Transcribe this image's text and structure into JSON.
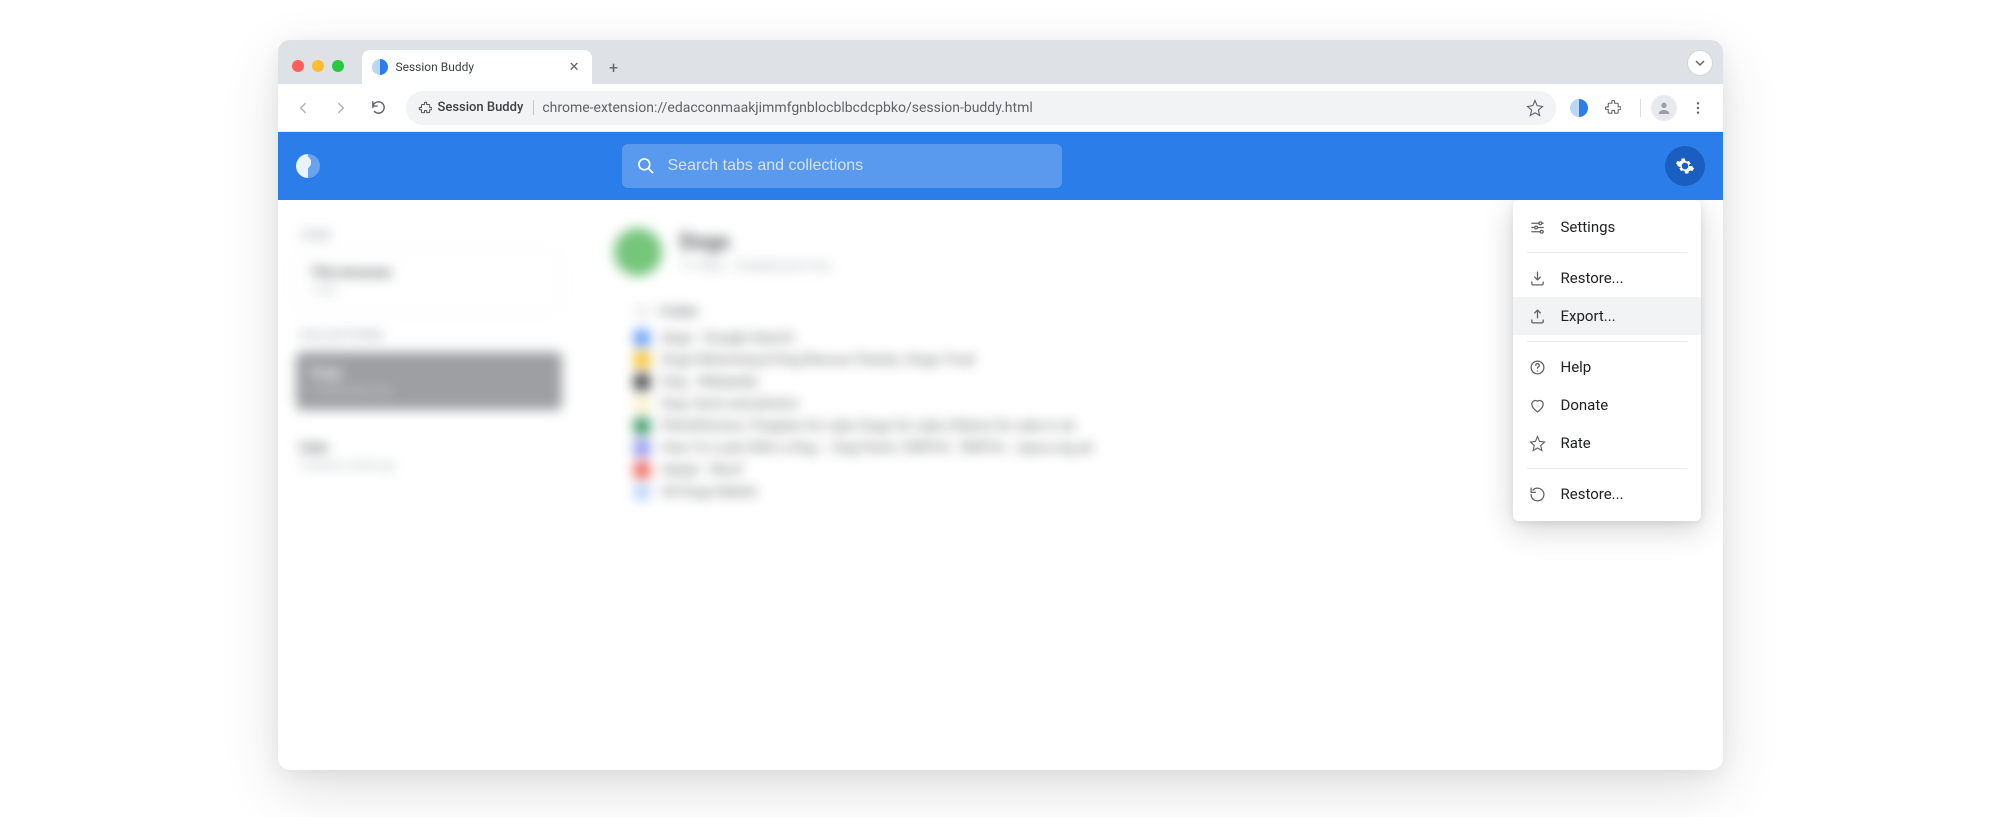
{
  "browser": {
    "tab_title": "Session Buddy",
    "omnibox_chip": "Session Buddy",
    "url": "chrome-extension://edacconmaakjimmfgnblocblbcdcpbko/session-buddy.html"
  },
  "app": {
    "search_placeholder": "Search tabs and collections"
  },
  "sidebar": {
    "section_tabs": "TABS",
    "this_browser": {
      "title": "This browser",
      "sub": "1 tab"
    },
    "section_collections": "COLLECTIONS",
    "dogs": {
      "title": "Dogs",
      "sub": "Created just now"
    },
    "cats": {
      "title": "Cats",
      "sub": "Created a while ago"
    }
  },
  "main": {
    "title": "Dogs",
    "subtitle": "17 links  ·  Created just now",
    "folder": "Folder",
    "links": [
      {
        "color": "#4285f4",
        "text": "dogs - Google Search"
      },
      {
        "color": "#f4b400",
        "text": "Dogs Rehoming & Dog Rescue Charity | Dogs Trust"
      },
      {
        "color": "#202124",
        "text": "Dog - Wikipedia"
      },
      {
        "color": "#fbecc0",
        "text": "Dog: facts and photos"
      },
      {
        "color": "#0b8043",
        "text": "Pets4Homes | Puppies for sale, Dogs for sale, Kittens for sale in uk"
      },
      {
        "color": "#7a7ceb",
        "text": "How To Look After a Dog – Dog Facts | RSPCA - RSPCA - rspca.org.uk"
      },
      {
        "color": "#ea4335",
        "text": "Adopt · Woof"
      },
      {
        "color": "#aecbfa",
        "text": "All Dogs Matter"
      }
    ]
  },
  "menu": {
    "settings": "Settings",
    "restore": "Restore...",
    "export": "Export...",
    "help": "Help",
    "donate": "Donate",
    "rate": "Rate",
    "restore2": "Restore..."
  }
}
